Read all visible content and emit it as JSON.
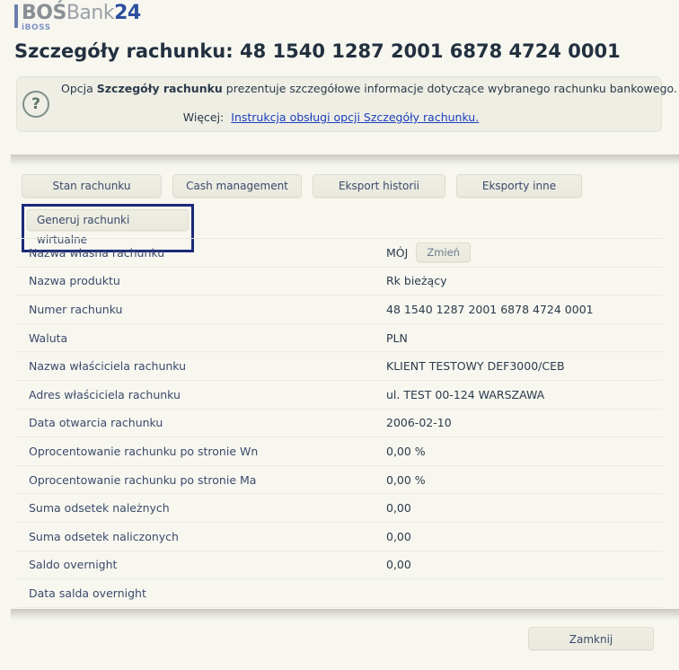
{
  "brand": {
    "bar_icon": "vertical-bar-icon",
    "bos": "BOŚ",
    "bank": "Bank",
    "twentyfour": "24",
    "sub": "iBOSS",
    "accent_blue": "#2d4f9e",
    "accent_gray": "#8a8f96"
  },
  "page": {
    "title": "Szczegóły rachunku: 48 1540 1287 2001 6878 4724 0001"
  },
  "info": {
    "icon": "question-mark-icon",
    "text_prefix": "Opcja ",
    "text_bold": "Szczegóły rachunku",
    "text_suffix": " prezentuje szczegółowe informacje dotyczące wybranego rachunku bankowego.",
    "more_label": "Więcej:",
    "link_text": "Instrukcja obsługi opcji Szczegóły rachunku.",
    "link_color": "#1c3fbf"
  },
  "tabs": {
    "row1": [
      {
        "label": "Stan rachunku"
      },
      {
        "label": "Cash management"
      },
      {
        "label": "Eksport historii"
      },
      {
        "label": "Eksporty inne"
      }
    ],
    "row2": [
      {
        "label": "Generuj rachunki wirtualne",
        "focused": true,
        "focus_color": "#1b2a7a"
      }
    ]
  },
  "details": {
    "rows": [
      {
        "label": "Nazwa własna rachunku",
        "value": "MÓJ",
        "action": "Zmień"
      },
      {
        "label": "Nazwa produktu",
        "value": "Rk bieżący"
      },
      {
        "label": "Numer rachunku",
        "value": "48 1540 1287 2001 6878 4724 0001"
      },
      {
        "label": "Waluta",
        "value": "PLN"
      },
      {
        "label": "Nazwa właściciela rachunku",
        "value": "KLIENT TESTOWY DEF3000/CEB"
      },
      {
        "label": "Adres właściciela rachunku",
        "value": "ul. TEST 00-124 WARSZAWA"
      },
      {
        "label": "Data otwarcia rachunku",
        "value": "2006-02-10"
      },
      {
        "label": "Oprocentowanie rachunku po stronie Wn",
        "value": "0,00 %"
      },
      {
        "label": "Oprocentowanie rachunku po stronie Ma",
        "value": "0,00 %"
      },
      {
        "label": "Suma odsetek należnych",
        "value": "0,00"
      },
      {
        "label": "Suma odsetek naliczonych",
        "value": "0,00"
      },
      {
        "label": "Saldo overnight",
        "value": "0,00"
      },
      {
        "label": "Data salda overnight",
        "value": ""
      }
    ]
  },
  "footer": {
    "close_label": "Zamknij"
  }
}
